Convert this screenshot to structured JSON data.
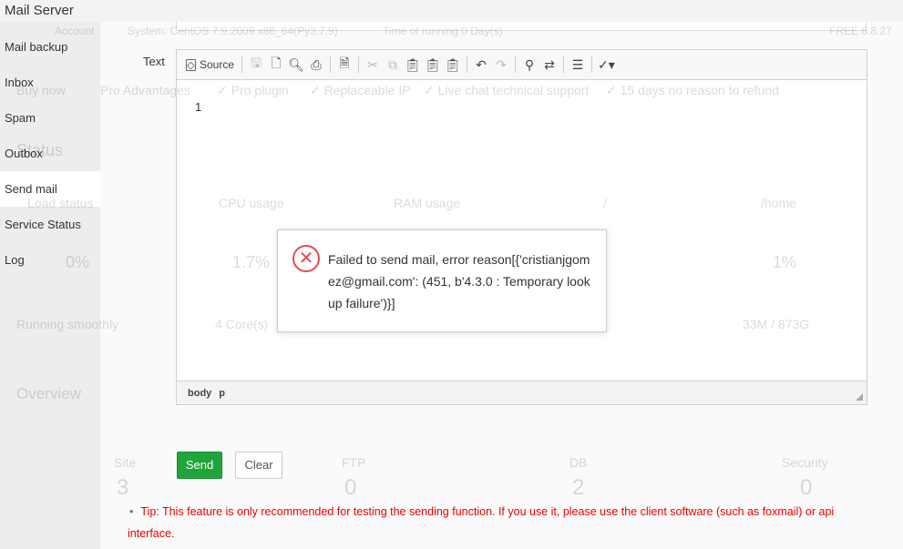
{
  "app": {
    "title": "Mail Server"
  },
  "sidebar": {
    "items": [
      {
        "label": "Mail backup",
        "active": false
      },
      {
        "label": "Inbox",
        "active": false
      },
      {
        "label": "Spam",
        "active": false
      },
      {
        "label": "Outbox",
        "active": false
      },
      {
        "label": "Send mail",
        "active": true
      },
      {
        "label": "Service Status",
        "active": false
      },
      {
        "label": "Log",
        "active": false
      }
    ]
  },
  "background": {
    "account": "Account",
    "system": "System: CentOS 7.9.2009 x86_64(Py3.7.9)",
    "uptime": "Time of running 0 Day(s)",
    "version": "FREE 6.8.27",
    "buy": "Buy now",
    "pro": "Pro Advantages",
    "f1": "✓ Pro plugin",
    "f2": "✓ Replaceable IP",
    "f3": "✓ Live chat technical support",
    "f4": "✓ 15 days no reason to refund",
    "status": "Status",
    "load": "Load status",
    "cpu": "CPU usage",
    "ram": "RAM usage",
    "root": "/",
    "home": "/home",
    "v_load": "0%",
    "v_cpu": "1.7%",
    "v_home": "1%",
    "running": "Running smoothly",
    "cores": "4 Core(s)",
    "disk": "33M / 873G",
    "overview": "Overview",
    "site": "Site",
    "ftp": "FTP",
    "db": "DB",
    "security": "Security",
    "n_site": "3",
    "n_ftp": "0",
    "n_db": "2",
    "n_sec": "0"
  },
  "form": {
    "text_label": "Text"
  },
  "editor": {
    "source_label": "Source",
    "line_number": "1",
    "status_path": [
      "body",
      "p"
    ]
  },
  "dialog": {
    "message": "Failed to send mail, error reason[{'cristianjgomez@gmail.com': (451, b'4.3.0 : Temporary lookup failure')}]",
    "icon": "error-circle-x",
    "color": "#e84a4a"
  },
  "buttons": {
    "send": "Send",
    "clear": "Clear"
  },
  "tip": "Tip: This feature is only recommended for testing the sending function. If you use it, please use the client software (such as foxmail) or api interface.",
  "colors": {
    "accent": "#20a53a",
    "tip": "#ee0000"
  }
}
